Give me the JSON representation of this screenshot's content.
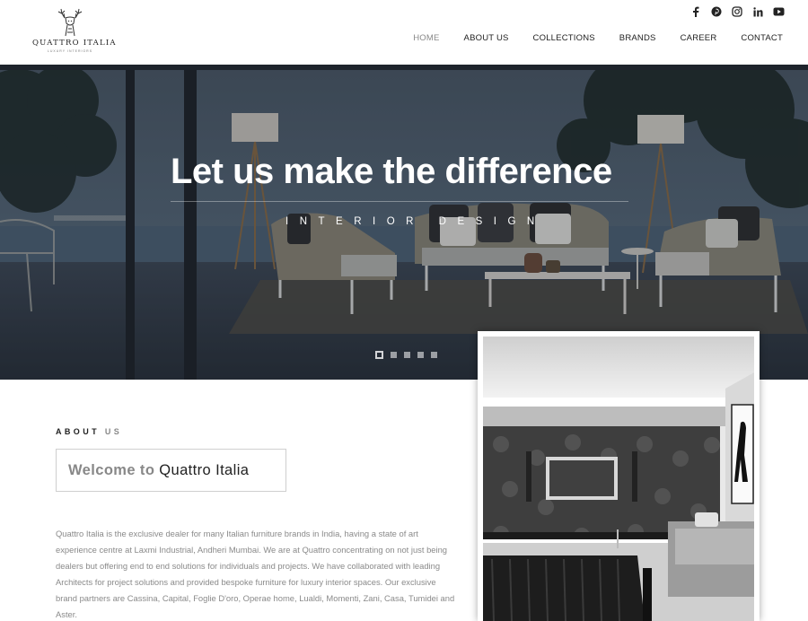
{
  "brand": {
    "name": "QUATTRO ITALIA",
    "tagline": "LUXURY INTERIORS"
  },
  "social": [
    {
      "icon": "facebook-icon",
      "glyph": "f"
    },
    {
      "icon": "pinterest-icon",
      "glyph": "P"
    },
    {
      "icon": "instagram-icon",
      "glyph": ""
    },
    {
      "icon": "linkedin-icon",
      "glyph": "in"
    },
    {
      "icon": "youtube-icon",
      "glyph": ""
    }
  ],
  "nav": {
    "items": [
      {
        "label": "HOME",
        "active": true
      },
      {
        "label": "ABOUT US",
        "active": false
      },
      {
        "label": "COLLECTIONS",
        "active": false
      },
      {
        "label": "BRANDS",
        "active": false
      },
      {
        "label": "CAREER",
        "active": false
      },
      {
        "label": "CONTACT",
        "active": false
      }
    ]
  },
  "hero": {
    "title": "Let us make the difference",
    "subtitle": "INTERIOR DESIGN",
    "slides": 5,
    "active_slide": 1
  },
  "about": {
    "label_bold": "ABOUT",
    "label_light": "US",
    "welcome_prefix": "Welcome to",
    "welcome_name": "Quattro Italia",
    "text": "Quattro Italia is the exclusive dealer for many Italian furniture brands in India, having a state of art experience centre at Laxmi Industrial, Andheri Mumbai. We are at Quattro concentrating on not just being dealers but offering end to end solutions for individuals and projects. We have collaborated with leading Architects for project solutions and provided bespoke furniture for luxury interior spaces. Our exclusive brand partners are Cassina, Capital, Foglie D'oro, Operae home, Lualdi, Momenti, Zani, Casa, Tumidei and Aster."
  },
  "colors": {
    "nav_active": "#888888",
    "text_muted": "#8a8a8a",
    "hero_overlay": "#36404c"
  }
}
